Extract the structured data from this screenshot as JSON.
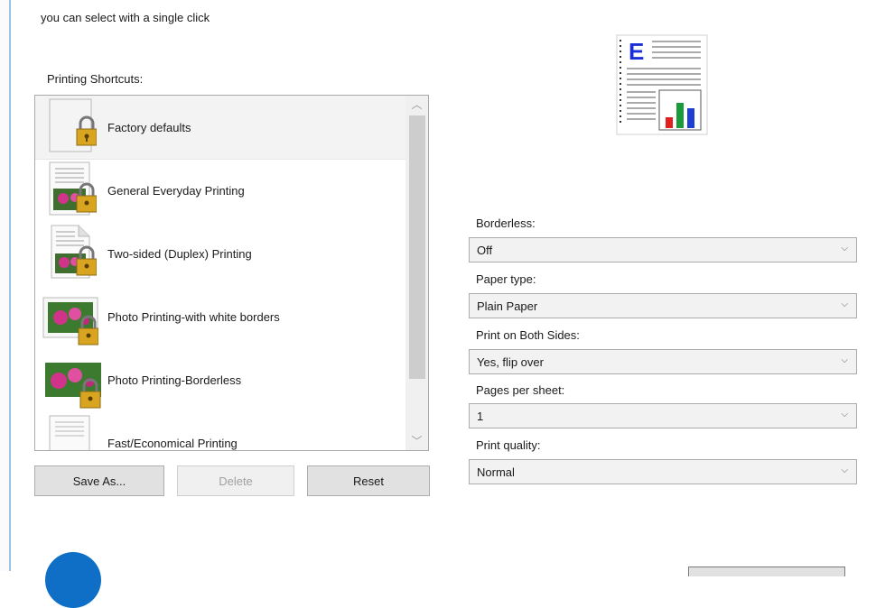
{
  "intro_text": "you can select with a single click",
  "shortcuts": {
    "label": "Printing Shortcuts:",
    "items": [
      {
        "label": "Factory defaults"
      },
      {
        "label": "General Everyday Printing"
      },
      {
        "label": "Two-sided (Duplex) Printing"
      },
      {
        "label": "Photo Printing-with white borders"
      },
      {
        "label": "Photo Printing-Borderless"
      },
      {
        "label": "Fast/Economical Printing"
      }
    ]
  },
  "buttons": {
    "save_as": "Save As...",
    "delete": "Delete",
    "reset": "Reset"
  },
  "settings": {
    "borderless": {
      "label": "Borderless:",
      "value": "Off"
    },
    "paper_type": {
      "label": "Paper type:",
      "value": "Plain Paper"
    },
    "both_sides": {
      "label": "Print on Both Sides:",
      "value": "Yes, flip over"
    },
    "pages_per_sheet": {
      "label": "Pages per sheet:",
      "value": "1"
    },
    "print_quality": {
      "label": "Print quality:",
      "value": "Normal"
    }
  },
  "preview_letter": "E",
  "colors": {
    "accent_blue": "#1a2fd6",
    "bar_red": "#e02020",
    "bar_green": "#1a9a3a",
    "bar_blue": "#1e3fd1",
    "lock_gold": "#d9a520",
    "flower_pink": "#d0348a"
  }
}
